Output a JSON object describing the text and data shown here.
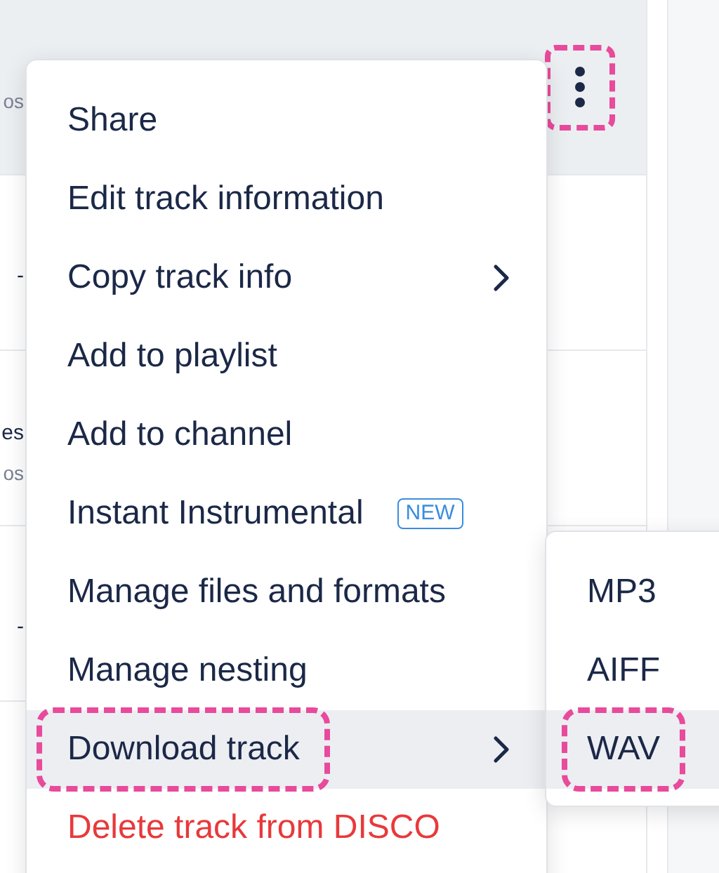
{
  "rows": [
    {
      "subtitle": "os",
      "selected": true,
      "menu_button": {
        "callout": true
      }
    },
    {
      "title": "-",
      "selected": false
    },
    {
      "title": "es",
      "subtitle": "os",
      "selected": false
    },
    {
      "title": "-",
      "selected": false
    }
  ],
  "menu": {
    "items": [
      {
        "label": "Share",
        "danger": false,
        "has_submenu": false,
        "selected": false,
        "callout": false
      },
      {
        "label": "Edit track information",
        "danger": false,
        "has_submenu": false,
        "selected": false,
        "callout": false
      },
      {
        "label": "Copy track info",
        "danger": false,
        "has_submenu": true,
        "selected": false,
        "callout": false
      },
      {
        "label": "Add to playlist",
        "danger": false,
        "has_submenu": false,
        "selected": false,
        "callout": false
      },
      {
        "label": "Add to channel",
        "danger": false,
        "has_submenu": false,
        "selected": false,
        "callout": false
      },
      {
        "label": "Instant Instrumental",
        "badge": "NEW",
        "danger": false,
        "has_submenu": false,
        "selected": false,
        "callout": false
      },
      {
        "label": "Manage files and formats",
        "danger": false,
        "has_submenu": false,
        "selected": false,
        "callout": false
      },
      {
        "label": "Manage nesting",
        "danger": false,
        "has_submenu": false,
        "selected": false,
        "callout": false
      },
      {
        "label": "Download track",
        "danger": false,
        "has_submenu": true,
        "selected": true,
        "callout": true
      },
      {
        "label": "Delete track from DISCO",
        "danger": true,
        "has_submenu": false,
        "selected": false,
        "callout": false
      }
    ]
  },
  "submenu": {
    "items": [
      {
        "label": "MP3",
        "selected": false,
        "callout": false
      },
      {
        "label": "AIFF",
        "selected": false,
        "callout": false
      },
      {
        "label": "WAV",
        "selected": true,
        "callout": true
      }
    ]
  }
}
